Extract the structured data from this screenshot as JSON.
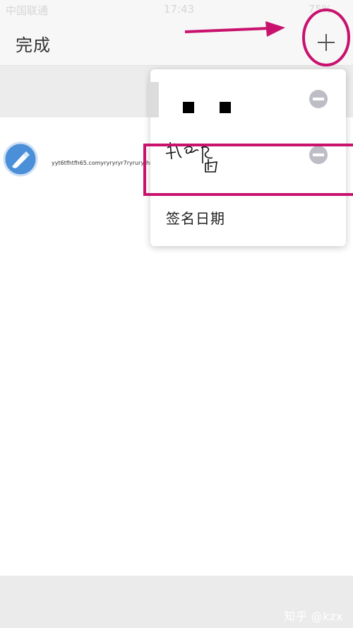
{
  "status_bar": {
    "carrier": "中国联通",
    "time": "17:43",
    "battery": "75%"
  },
  "nav": {
    "done_label": "完成",
    "add_icon": "plus-icon"
  },
  "file": {
    "icon": "document-icon",
    "name": "yyt6tfhtfh65.comyryryryr7ryruryfhru..."
  },
  "popup": {
    "signatures": [
      {
        "icon": "signature-image",
        "remove_icon": "remove-icon"
      },
      {
        "icon": "handwritten-signature-image",
        "remove_icon": "remove-icon"
      }
    ],
    "date_option": "签名日期"
  },
  "annotations": {
    "color": "#c8126e"
  },
  "watermark": "知乎 @kzx"
}
